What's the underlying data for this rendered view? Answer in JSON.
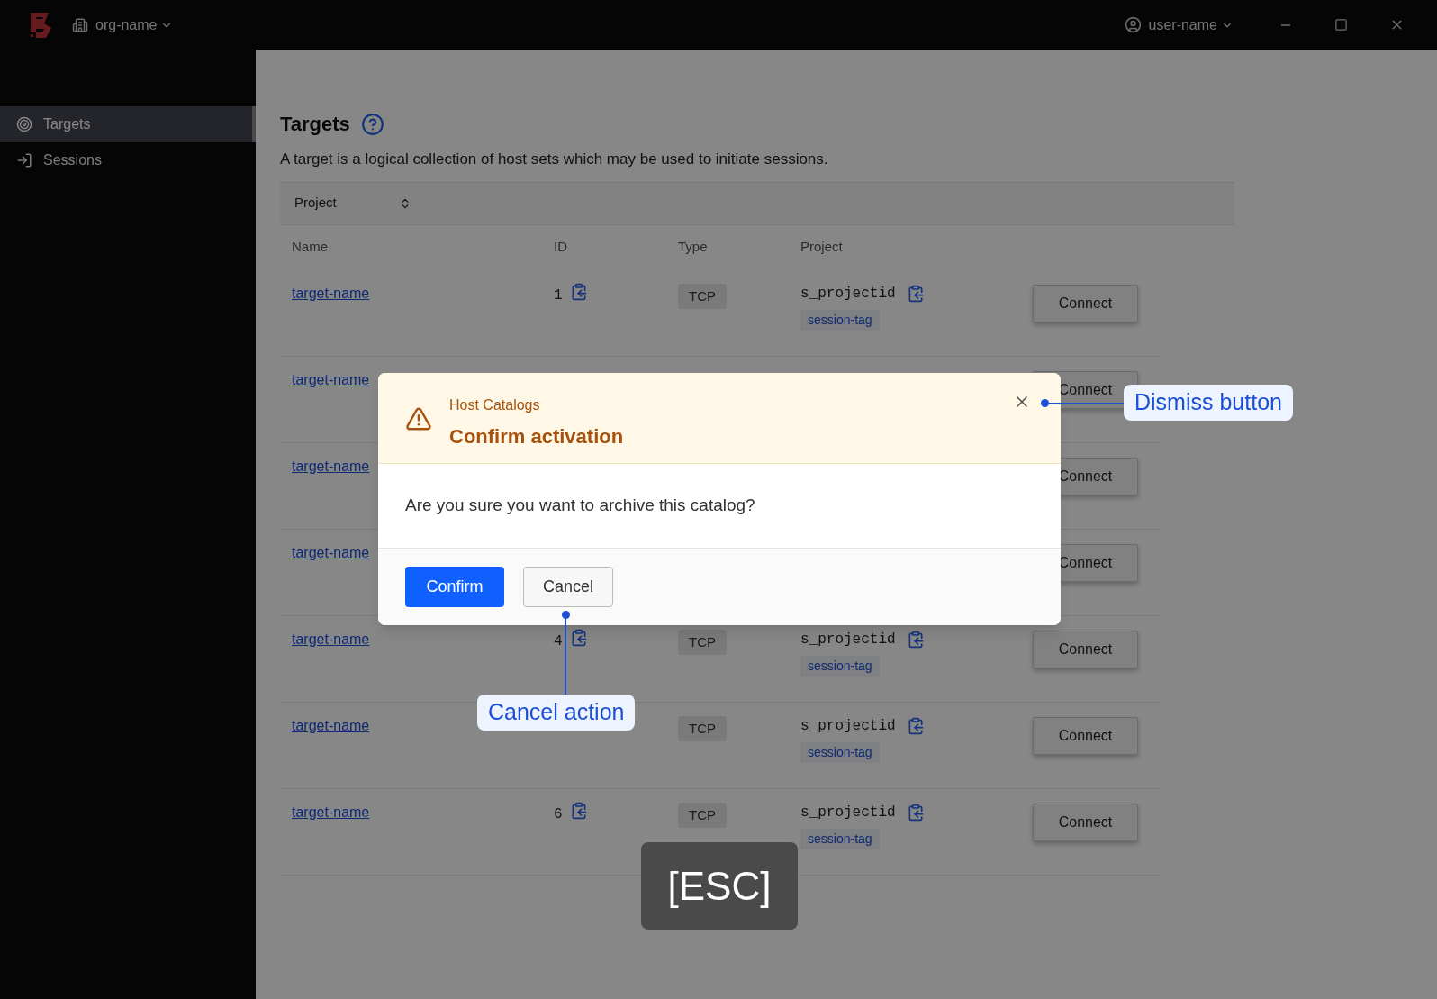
{
  "titlebar": {
    "org": "org-name",
    "user": "user-name"
  },
  "sidebar": {
    "items": [
      {
        "label": "Targets",
        "selected": true
      },
      {
        "label": "Sessions",
        "selected": false
      }
    ]
  },
  "page": {
    "title": "Targets",
    "description": "A target is a logical collection of host sets which may be used to initiate sessions."
  },
  "filter": {
    "label": "Project"
  },
  "table": {
    "columns": [
      "Name",
      "ID",
      "Type",
      "Project"
    ],
    "rows": [
      {
        "name": "target-name",
        "id": "1",
        "type": "TCP",
        "project": "s_projectid",
        "tag": "session-tag",
        "action": "Connect"
      },
      {
        "name": "target-name",
        "action": "Connect"
      },
      {
        "name": "target-name",
        "action": "Connect"
      },
      {
        "name": "target-name",
        "action": "Connect"
      },
      {
        "name": "target-name",
        "id": "4",
        "type": "TCP",
        "project": "s_projectid",
        "tag": "session-tag",
        "action": "Connect"
      },
      {
        "name": "target-name",
        "type": "TCP",
        "project": "s_projectid",
        "tag": "session-tag",
        "action": "Connect"
      },
      {
        "name": "target-name",
        "id": "6",
        "type": "TCP",
        "project": "s_projectid",
        "tag": "session-tag",
        "action": "Connect"
      }
    ]
  },
  "dialog": {
    "eyebrow": "Host Catalogs",
    "title": "Confirm activation",
    "message": "Are you sure you want to archive this catalog?",
    "buttons": [
      {
        "label": "Confirm",
        "kind": "primary"
      },
      {
        "label": "Cancel",
        "kind": "secondary"
      }
    ]
  },
  "annotations": [
    {
      "text": "Dismiss button",
      "kind": "dismiss"
    },
    {
      "text": "Cancel action",
      "kind": "cancel"
    }
  ],
  "key_hint": "[ESC]"
}
